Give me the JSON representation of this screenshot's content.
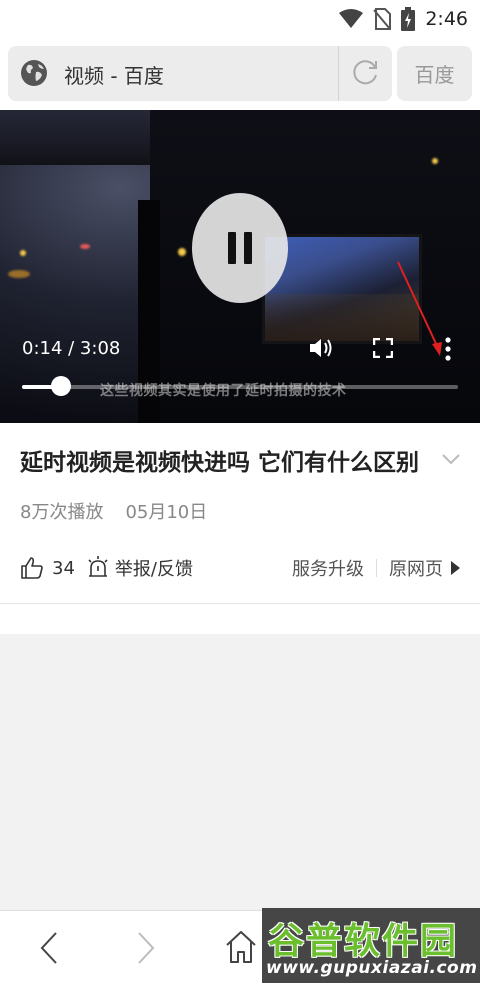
{
  "status_bar": {
    "time": "2:46"
  },
  "address_bar": {
    "page_title": "视频 - 百度",
    "action_button": "百度"
  },
  "video": {
    "current_time": "0:14",
    "duration": "3:08",
    "time_label": "0:14 / 3:08",
    "progress_fraction": 0.09,
    "subtitle": "这些视频其实是使用了延时拍摄的技术",
    "state": "playing"
  },
  "info": {
    "title": "延时视频是视频快进吗 它们有什么区别",
    "views": "8万次播放",
    "date": "05月10日",
    "likes": "34",
    "report_label": "举报/反馈",
    "service_upgrade": "服务升级",
    "original_page": "原网页"
  },
  "watermark": {
    "name": "谷普软件园",
    "url": "www.gupuxiazai.com"
  },
  "colors": {
    "watermark_green": "#6bbf2e",
    "annotation_red": "#e02020"
  }
}
